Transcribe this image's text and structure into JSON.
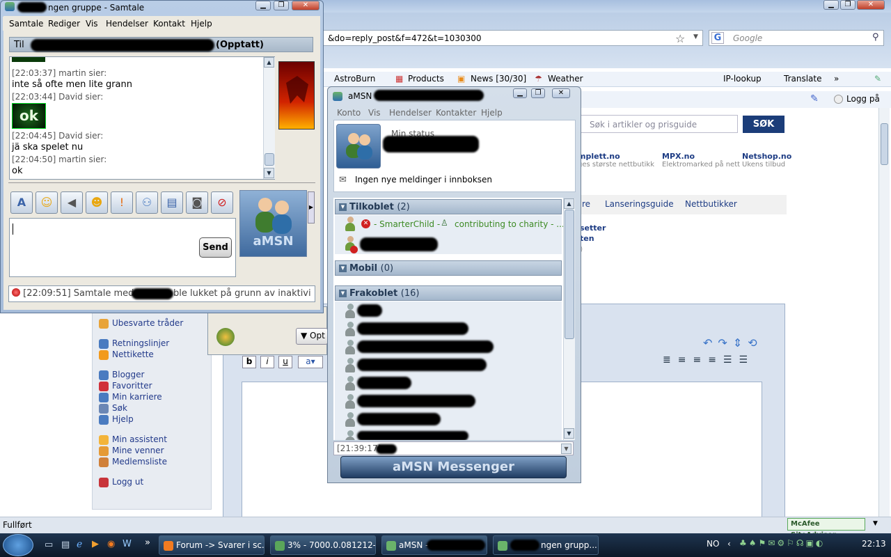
{
  "firefox": {
    "url_fragment": "&do=reply_post&f=472&t=1030300",
    "search_placeholder": "Google",
    "search_engine_letter": "G",
    "bookmarks": [
      "AstroBurn",
      "Products",
      "News [30/30]",
      "Weather",
      "IP-lookup",
      "Translate",
      "»"
    ],
    "login_label": "Logg på",
    "site_search_placeholder": "Søk i artikler og prisguide",
    "site_search_button": "SØK",
    "stores": [
      {
        "name": "mplett.no",
        "desc": "ges største nettbutikk"
      },
      {
        "name": "MPX.no",
        "desc": "Elektromarked på nett"
      },
      {
        "name": "Netshop.no",
        "desc": "Ukens tilbud"
      }
    ],
    "tabs": [
      "re",
      "Lanseringsguide",
      "Nettbutikker"
    ],
    "side_links_partial": [
      "setter",
      "ten",
      ")"
    ],
    "sidebar": {
      "items": [
        {
          "label": "Ubesvarte tråder",
          "icon": "document-icon",
          "color": "#e8a43a"
        },
        {
          "label": "Retningslinjer",
          "icon": "rules-icon",
          "color": "#4a7bc0"
        },
        {
          "label": "Nettikette",
          "icon": "warning-icon",
          "color": "#f29a1d"
        },
        {
          "label": "Blogger",
          "icon": "blog-icon",
          "color": "#4a7bc0"
        },
        {
          "label": "Favoritter",
          "icon": "heart-icon",
          "color": "#d0303a"
        },
        {
          "label": "Min karriere",
          "icon": "people-icon",
          "color": "#4a7bc0"
        },
        {
          "label": "Søk",
          "icon": "search-icon",
          "color": "#6b87b5"
        },
        {
          "label": "Hjelp",
          "icon": "help-icon",
          "color": "#4a7bc0"
        },
        {
          "label": "Min assistent",
          "icon": "smiley-icon",
          "color": "#f3b43a"
        },
        {
          "label": "Mine venner",
          "icon": "friends-icon",
          "color": "#e59a36"
        },
        {
          "label": "Medlemsliste",
          "icon": "members-icon",
          "color": "#d0803a"
        },
        {
          "label": "Logg ut",
          "icon": "logout-icon",
          "color": "#c8343a"
        }
      ]
    },
    "editor_mini_option": "Opt",
    "status_text": "Fullført",
    "mcafee_label": "McAfee SiteAdvisor"
  },
  "chat": {
    "title": "ngen gruppe - Samtale",
    "menu": [
      "Samtale",
      "Rediger",
      "Vis",
      "Hendelser",
      "Kontakt",
      "Hjelp"
    ],
    "to_prefix": "Til",
    "to_suffix": "(Opptatt)",
    "log": [
      {
        "meta": "[22:03:37] martin sier:",
        "text": "inte så ofte men lite grann"
      },
      {
        "meta": "[22:03:44] David sier:",
        "text": ""
      },
      {
        "meta": "[22:04:45] David sier:",
        "text": "jä ska spelet nu"
      },
      {
        "meta": "[22:04:50] martin sier:",
        "text": "ok"
      }
    ],
    "ok_emoticon": "ok",
    "send_label": "Send",
    "avatar_label": "aMSN",
    "status_line": "[22:09:51] Samtale med",
    "status_tail": "ble lukket på grunn av inaktivi"
  },
  "amsn": {
    "title": "aMSN",
    "menu": [
      "Konto",
      "Vis",
      "Hendelser",
      "Kontakter",
      "Hjelp"
    ],
    "my_status": "Min status",
    "inbox": "Ingen nye meldinger i innboksen",
    "groups": [
      {
        "name": "Tilkoblet",
        "count": "(2)"
      },
      {
        "name": "Mobil",
        "count": "(0)"
      },
      {
        "name": "Frakoblet",
        "count": "(16)"
      }
    ],
    "online_contact": "- SmarterChild -",
    "online_contact_extra": "contributing to charity - ...",
    "bottom_time": "[21:39:17]",
    "banner": "aMSN Messenger"
  },
  "taskbar": {
    "tasks": [
      "Forum -> Svarer i sc...",
      "3% - 7000.0.081212-...",
      "aMSN -",
      "ngen grupp..."
    ],
    "lang": "NO",
    "clock": "22:13"
  }
}
